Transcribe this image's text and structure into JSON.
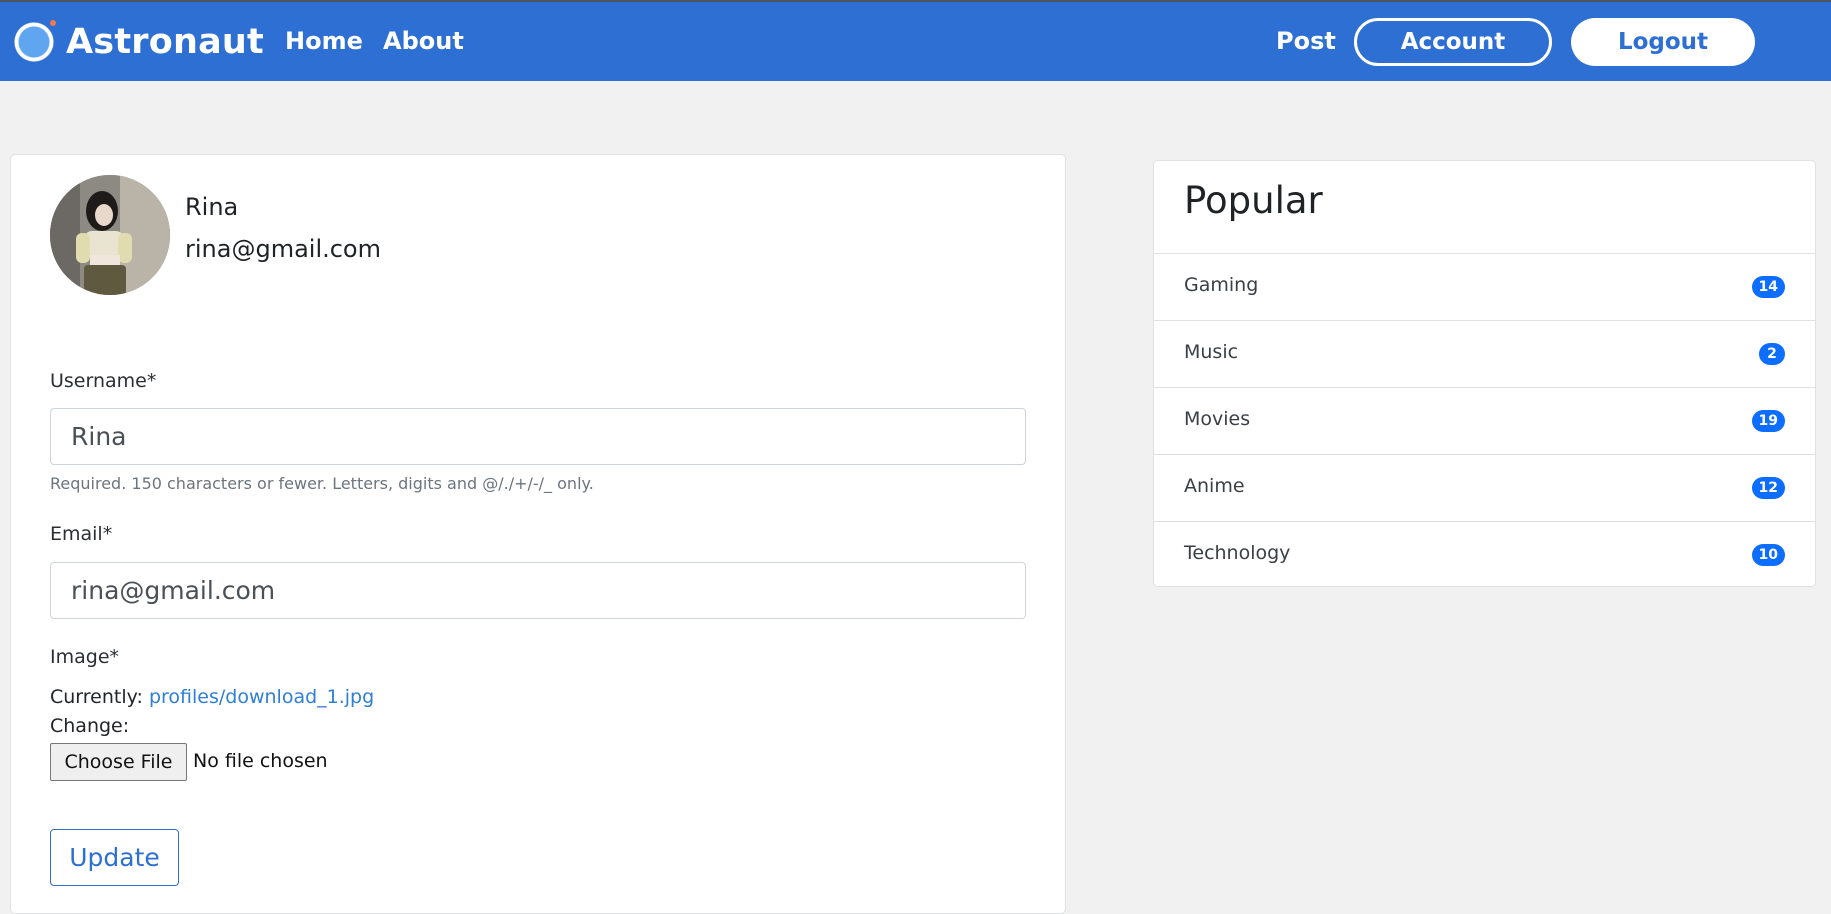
{
  "navbar": {
    "brand": "Astronaut",
    "links": {
      "home": "Home",
      "about": "About",
      "post": "Post"
    },
    "account_label": "Account",
    "logout_label": "Logout",
    "colors": {
      "bar": "#2d6fd3",
      "text": "#ffffff"
    }
  },
  "profile": {
    "name": "Rina",
    "email": "rina@gmail.com",
    "avatar_icon": "profile-photo"
  },
  "form": {
    "username_label": "Username*",
    "username_value": "Rina",
    "username_help": "Required. 150 characters or fewer. Letters, digits and @/./+/-/_ only.",
    "email_label": "Email*",
    "email_value": "rina@gmail.com",
    "image_label": "Image*",
    "currently_label": "Currently:",
    "currently_file": "profiles/download_1.jpg",
    "change_label": "Change:",
    "choose_file_label": "Choose File",
    "file_status": "No file chosen",
    "update_label": "Update"
  },
  "popular": {
    "title": "Popular",
    "items": [
      {
        "label": "Gaming",
        "count": "14"
      },
      {
        "label": "Music",
        "count": "2"
      },
      {
        "label": "Movies",
        "count": "19"
      },
      {
        "label": "Anime",
        "count": "12"
      },
      {
        "label": "Technology",
        "count": "10"
      }
    ],
    "badge_color": "#0d6efd"
  }
}
